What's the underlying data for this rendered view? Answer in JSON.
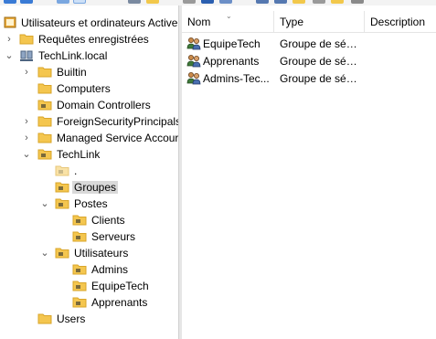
{
  "tree": {
    "root": {
      "label": "Utilisateurs et ordinateurs Active"
    },
    "items": [
      {
        "label": "Requêtes enregistrées",
        "expander": "›"
      },
      {
        "label": "TechLink.local",
        "expander": "⌄"
      },
      {
        "label": "Builtin",
        "expander": "›"
      },
      {
        "label": "Computers",
        "expander": ""
      },
      {
        "label": "Domain Controllers",
        "expander": ""
      },
      {
        "label": "ForeignSecurityPrincipals",
        "expander": "›"
      },
      {
        "label": "Managed Service Accour",
        "expander": "›"
      },
      {
        "label": "TechLink",
        "expander": "⌄"
      },
      {
        "label": ".",
        "expander": ""
      },
      {
        "label": "Groupes",
        "expander": ""
      },
      {
        "label": "Postes",
        "expander": "⌄"
      },
      {
        "label": "Clients",
        "expander": ""
      },
      {
        "label": "Serveurs",
        "expander": ""
      },
      {
        "label": "Utilisateurs",
        "expander": "⌄"
      },
      {
        "label": "Admins",
        "expander": ""
      },
      {
        "label": "EquipeTech",
        "expander": ""
      },
      {
        "label": "Apprenants",
        "expander": ""
      },
      {
        "label": "Users",
        "expander": ""
      }
    ],
    "selected": "Groupes"
  },
  "list": {
    "columns": {
      "name": "Nom",
      "type": "Type",
      "description": "Description"
    },
    "rows": [
      {
        "name": "EquipeTech",
        "type": "Groupe de séc..."
      },
      {
        "name": "Apprenants",
        "type": "Groupe de séc..."
      },
      {
        "name": "Admins-Tec...",
        "type": "Groupe de séc..."
      }
    ]
  },
  "icons": {
    "folder": "folder-icon",
    "ou": "organizational-unit-icon",
    "group": "group-icon",
    "domain": "domain-icon",
    "console": "console-root-icon"
  },
  "colors": {
    "folder": "#f4c64f",
    "folder_dark": "#d9a52a",
    "selection": "#d9d9d9"
  }
}
